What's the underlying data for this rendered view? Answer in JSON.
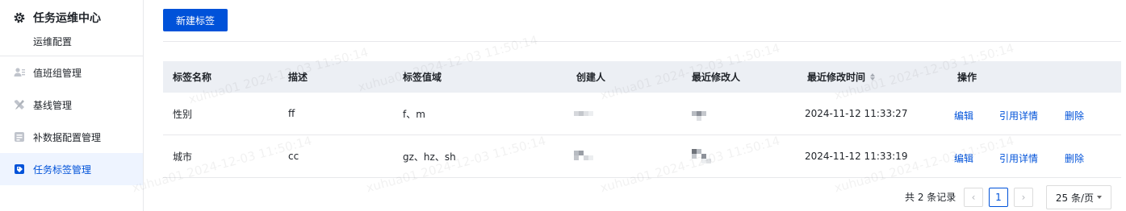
{
  "sidebar": {
    "title": "任务运维中心",
    "subtitle": "运维配置",
    "items": [
      {
        "label": "值班组管理",
        "icon": "user-group-icon",
        "active": false
      },
      {
        "label": "基线管理",
        "icon": "tools-icon",
        "active": false
      },
      {
        "label": "补数据配置管理",
        "icon": "data-config-icon",
        "active": false
      },
      {
        "label": "任务标签管理",
        "icon": "tag-icon",
        "active": true
      }
    ]
  },
  "toolbar": {
    "new_label": "新建标签"
  },
  "table": {
    "columns": [
      "标签名称",
      "描述",
      "标签值域",
      "创建人",
      "最近修改人",
      "最近修改时间",
      "操作"
    ],
    "rows": [
      {
        "name": "性别",
        "desc": "ff",
        "values": "f、m",
        "modified": "2024-11-12 11:33:27"
      },
      {
        "name": "城市",
        "desc": "cc",
        "values": "gz、hz、sh",
        "modified": "2024-11-12 11:33:19"
      }
    ],
    "actions": {
      "edit": "编辑",
      "refs": "引用详情",
      "delete": "删除"
    }
  },
  "pagination": {
    "total_text": "共 2 条记录",
    "current_page": "1",
    "prev": "‹",
    "next": "›",
    "page_size": "25 条/页"
  },
  "watermark": "xuhua01 2024-12-03 11:50:14",
  "colors": {
    "primary": "#0052d9",
    "header_bg": "#eceff4",
    "active_bg": "#eef4ff"
  }
}
